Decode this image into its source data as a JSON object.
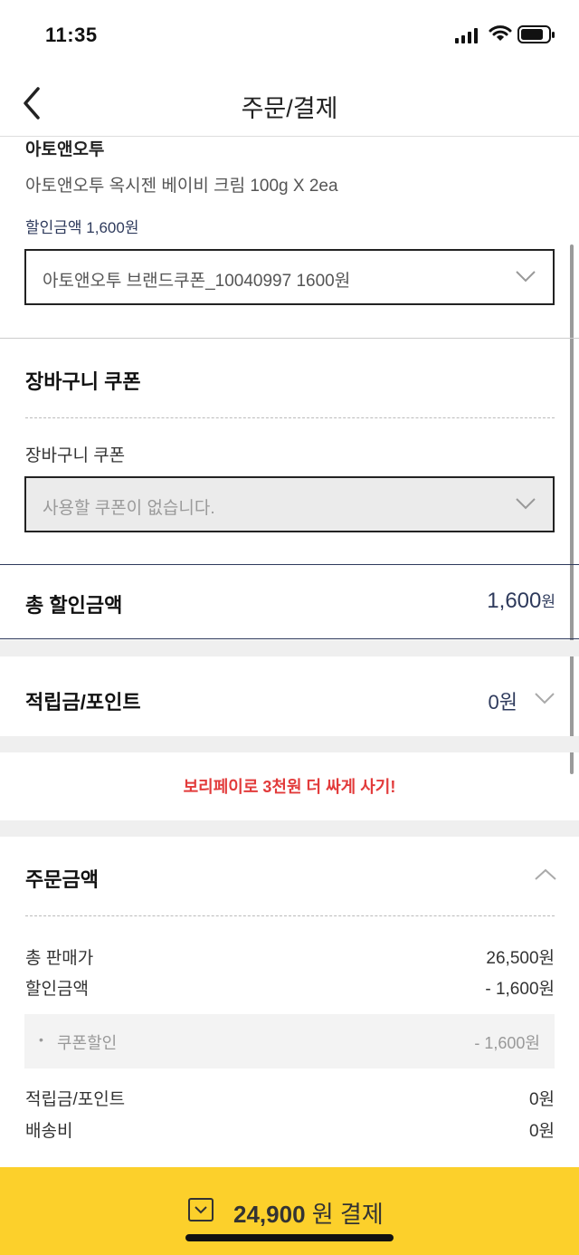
{
  "status_bar": {
    "time": "11:35"
  },
  "header": {
    "title": "주문/결제"
  },
  "product": {
    "brand": "아토앤오투",
    "name": "아토앤오투 옥시젠 베이비 크림 100g X 2ea",
    "discount_text": "할인금액 1,600원",
    "coupon_select": "아토앤오투 브랜드쿠폰_10040997 1600원"
  },
  "cart_coupon": {
    "heading": "장바구니 쿠폰",
    "label": "장바구니 쿠폰",
    "select_value": "사용할 쿠폰이 없습니다."
  },
  "total_discount": {
    "label": "총 할인금액",
    "amount": "1,600",
    "unit": "원"
  },
  "points": {
    "label": "적립금/포인트",
    "amount": "0원"
  },
  "promo": {
    "text": "보리페이로 3천원 더 싸게 사기!"
  },
  "order_amount": {
    "heading": "주문금액",
    "rows": [
      {
        "label": "총 판매가",
        "value": "26,500원"
      },
      {
        "label": "할인금액",
        "value": "- 1,600원"
      }
    ],
    "sub": {
      "label": "쿠폰할인",
      "value": "- 1,600원"
    },
    "rows2": [
      {
        "label": "적립금/포인트",
        "value": "0원"
      },
      {
        "label": "배송비",
        "value": "0원"
      }
    ]
  },
  "pay_button": {
    "amount": "24,900",
    "label": "원 결제"
  },
  "colors": {
    "accent_yellow": "#fcd02b",
    "promo_red": "#e23b3b",
    "navy": "#2e3a5c"
  }
}
